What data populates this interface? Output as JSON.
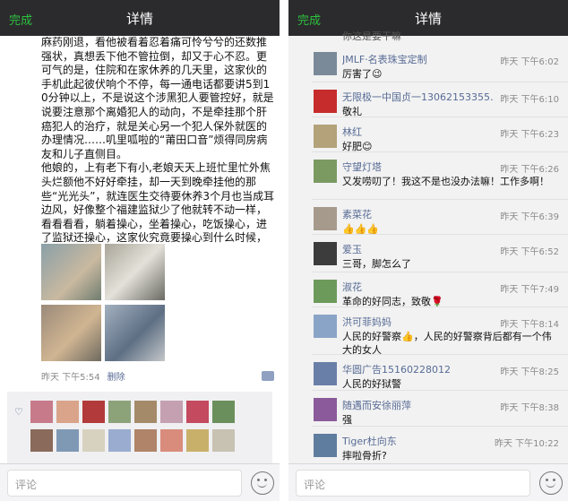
{
  "left": {
    "topbar": {
      "done_label": "完成",
      "title": "详情"
    },
    "post_text": "麻药刚退，看他被看着忍着痛可怜兮兮的还数推强状，真想丢下他不管拉倒，却又于心不忍。更可气的是，住院和在家休养的几天里，这家伙的手机此起彼伏响个不停，每一通电话都要讲5到10分钟以上，不是说这个涉黑犯人要管控好，就是说要注意那个离婚犯人的动向，不是牵挂那个肝癌犯人的治疗，就是关心另一个犯人保外就医的办理情况……叽里呱啦的“莆田口音”烦得同房病友和儿子直侧目。\n他娘的，上有老下有小,老娘天天上班忙里忙外焦头烂额他不好好牵挂，却一天到晚牵挂他的那些“光光头”，就连医生交待要休养3个月也当成耳边风，好像整个福建监狱少了他就转不动一样，看看看看，躺着操心，坐着操心，吃饭操心，进了监狱还操心，这家伙究竟要操心到什么时候，呜呜……",
    "photos": [
      {
        "label": "hospital-photo"
      },
      {
        "label": "hospital-photo"
      },
      {
        "label": "hospital-photo"
      },
      {
        "label": "hospital-photo"
      },
      {
        "label": "prison-photo"
      },
      {
        "label": "prison-photo"
      }
    ],
    "timestamp": "昨天  下午5:54",
    "delete_label": "删除",
    "comment_placeholder": "评论",
    "icons": {
      "heart": "heart-icon",
      "comment": "comment-icon",
      "emoji": "emoji-icon"
    }
  },
  "right": {
    "topbar": {
      "done_label": "完成",
      "title": "详情"
    },
    "partial_text": "你这是要干嘛",
    "comments": [
      {
        "name": "JMLF·名表珠宝定制",
        "time": "昨天 下午6:02",
        "text": "厉害了😉",
        "color": "#7b8a99"
      },
      {
        "name": "无限极一中国贞一13062153355…",
        "time": "昨天 下午6:10",
        "text": "敬礼",
        "color": "#c62c2c"
      },
      {
        "name": "林红",
        "time": "昨天 下午6:23",
        "text": "好肥😊",
        "color": "#b3a27a"
      },
      {
        "name": "守望灯塔",
        "time": "昨天 下午6:26",
        "text": "又发唠叨了！我这不是也没办法嘛！工作多啊！",
        "color": "#7a9a62"
      },
      {
        "name": "素菜花",
        "time": "昨天 下午6:39",
        "text": "👍👍👍",
        "color": "#a59a8c"
      },
      {
        "name": "爱玉",
        "time": "昨天 下午6:52",
        "text": "三哥，脚怎么了",
        "color": "#3c3c3c"
      },
      {
        "name": "淑花",
        "time": "昨天 下午7:49",
        "text": "革命的好同志，致敬🌹",
        "color": "#6c9a5a"
      },
      {
        "name": "洪可菲妈妈",
        "time": "昨天 下午8:14",
        "text": "人民的好警察👍，人民的好警察背后都有一个伟大的女人",
        "color": "#8aa4c8"
      },
      {
        "name": "华圆广告15160228012",
        "time": "昨天 下午8:25",
        "text": "人民的好狱警",
        "color": "#6a7fa8"
      },
      {
        "name": "随遇而安徐丽萍",
        "time": "昨天 下午8:38",
        "text": "强",
        "color": "#8a5a9a"
      },
      {
        "name": "Tiger杜向东",
        "time": "昨天 下午10:22",
        "text": "摔啦骨折?",
        "color": "#5f7d9e"
      }
    ],
    "comment_placeholder": "评论"
  },
  "colors": {
    "accent_green": "#2dc13e",
    "link_blue": "#576b95",
    "topbar": "#2b2b2d"
  }
}
